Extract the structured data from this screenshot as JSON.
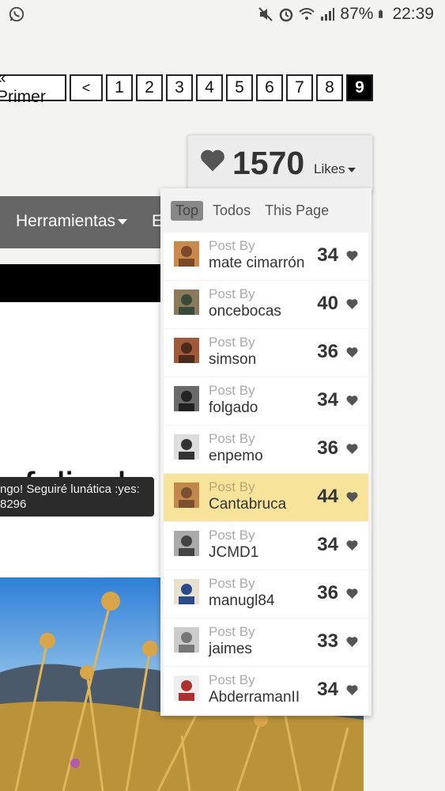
{
  "status_bar": {
    "battery": "87%",
    "time": "22:39",
    "left_icon": "whatsapp-icon",
    "right_icons": [
      "mute-icon",
      "alarm-icon",
      "wifi-icon",
      "signal-icon",
      "battery-icon"
    ]
  },
  "pagination": {
    "first_label": "« Primer",
    "prev_label": "<",
    "pages": [
      "1",
      "2",
      "3",
      "4",
      "5",
      "6",
      "7",
      "8",
      "9"
    ],
    "current": "9"
  },
  "nav": {
    "item": "Herramientas",
    "next_partial": "E"
  },
  "post": {
    "big_text": "feliz de",
    "tooltip_line1": "ngo! Seguiré lunática :yes:",
    "tooltip_line2": "8296"
  },
  "likes": {
    "count": "1570",
    "label": "Likes",
    "tabs": [
      "Top",
      "Todos",
      "This Page"
    ],
    "active_tab": "Top",
    "post_by_label": "Post By",
    "rows": [
      {
        "user": "mate cimarrón",
        "count": "34"
      },
      {
        "user": "oncebocas",
        "count": "40"
      },
      {
        "user": "simson",
        "count": "36"
      },
      {
        "user": "folgado",
        "count": "34"
      },
      {
        "user": "enpemo",
        "count": "36"
      },
      {
        "user": "Cantabruca",
        "count": "44"
      },
      {
        "user": "JCMD1",
        "count": "34"
      },
      {
        "user": "manugl84",
        "count": "36"
      },
      {
        "user": "jaimes",
        "count": "33"
      },
      {
        "user": "AbderramanII",
        "count": "34"
      }
    ],
    "highlighted_user": "Cantabruca"
  },
  "colors": {
    "highlight": "#f7e39a",
    "nav_bg": "#666666",
    "heart": "#555555"
  }
}
